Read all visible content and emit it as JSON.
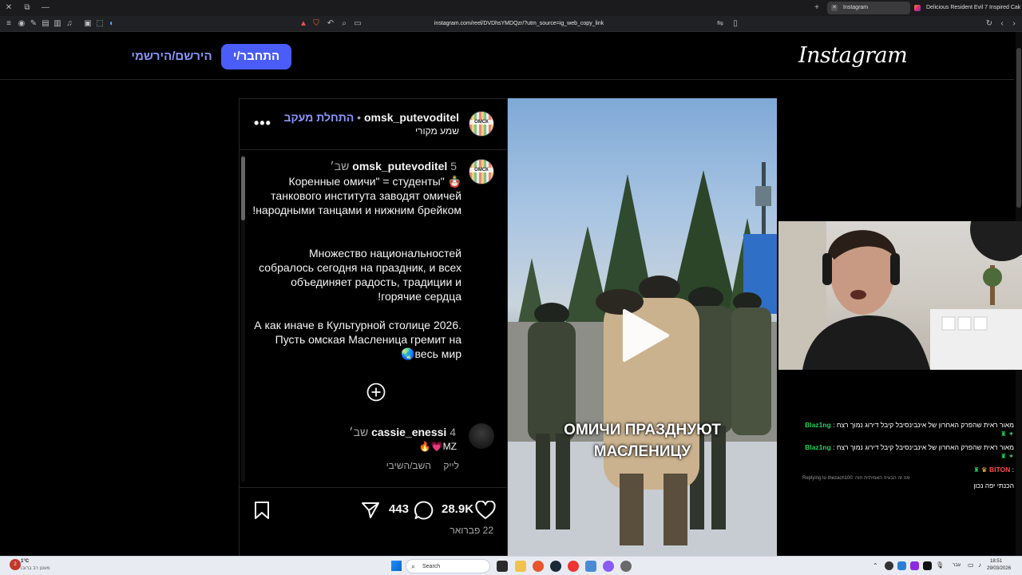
{
  "browser": {
    "tabs": [
      {
        "title": "Instagram",
        "active": true
      },
      {
        "title": "Delicious Resident Evil 7 Inspired Cak",
        "active": false
      }
    ],
    "url": "instagram.com/reel/DVDhsYMDQzr/?utm_source=ig_web_copy_link"
  },
  "header": {
    "logo": "Instagram",
    "login_label": "התחבר/י",
    "signup_label": "הירשם/הירשמי"
  },
  "post": {
    "author": "omsk_putevoditel",
    "follow_label": "התחלת מעקב",
    "audio_label": "שמע מקורי",
    "avatar_text": "ОМСК",
    "caption_time": "5 שב׳",
    "caption_p1": "Коренные омичи\" = студенты\" 🪆 танкового института заводят омичей народными танцами и нижним брейком!",
    "caption_p2": "Множество национальностей собралось сегодня на праздник, и всех объединяет радость, традиции и горячие сердца!",
    "caption_p3": "А как иначе в Культурной столице 2026. Пусть омская Масленица гремит на весь мир🌏",
    "comment": {
      "user": "cassie_enessi",
      "time": "4 שב׳",
      "text": "MZ💗🔥",
      "like_label": "לייק",
      "reply_label": "השב/השיבי"
    },
    "likes": "28.9K",
    "comments": "443",
    "date": "22 פברואר"
  },
  "video": {
    "overlay_line1": "ОМИЧИ ПРАЗДНУЮТ",
    "overlay_line2": "МАСЛЕНИЦУ"
  },
  "chat": [
    {
      "user": "Blaz1ng",
      "user_color": "#20d060",
      "text": "מאור ראית שהפרק האחרון של אינבינסיבל קיבל דירוג נמוך רצח"
    },
    {
      "user": "Blaz1ng",
      "user_color": "#20d060",
      "text": "מאור ראית שהפרק האחרון של אינבינסיבל קיבל דירוג נמוך רצח"
    },
    {
      "user": "BITON",
      "user_color": "#ff4b4b",
      "reply_note": "Replying to thezach100: מה זה הבעיה האמיתית הזה",
      "text": "הכנתי יפה נכון"
    }
  ],
  "taskbar": {
    "search_placeholder": "Search",
    "weather_temp": "1°C",
    "weather_desc": "מעונן רב ברובו",
    "time": "18:51",
    "date": "29/03/2026",
    "lang": "עבר"
  },
  "colors": {
    "ig_blue": "#4a5df9",
    "ig_link": "#8a95ff",
    "follow": "#8a95ff"
  }
}
